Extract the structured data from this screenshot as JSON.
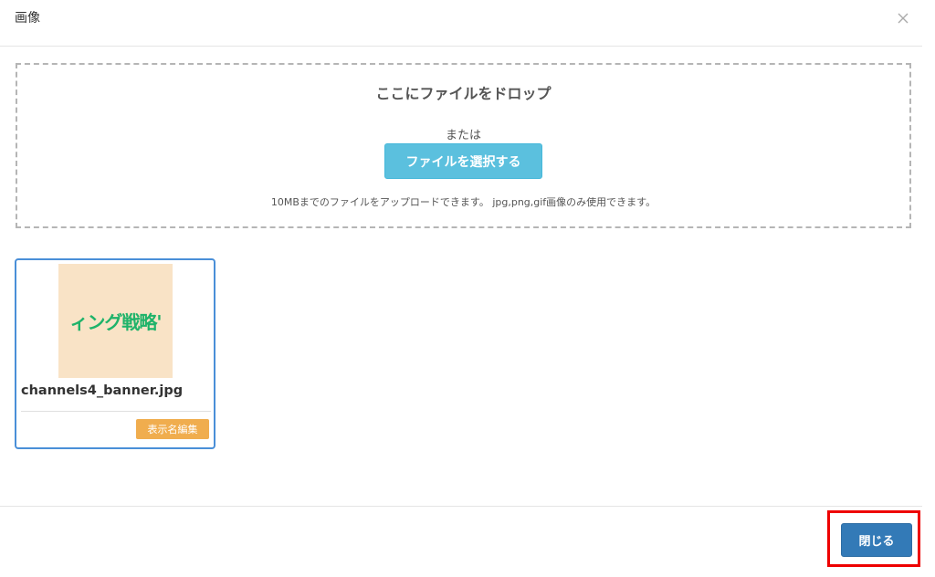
{
  "dialog": {
    "title": "画像",
    "close_icon": "close-icon"
  },
  "dropzone": {
    "title": "ここにファイルをドロップ",
    "or_text": "または",
    "select_button": "ファイルを選択する",
    "hint": "10MBまでのファイルをアップロードできます。 jpg,png,gif画像のみ使用できます。"
  },
  "files": [
    {
      "thumbnail_text": "ィング戦略'",
      "name": "channels4_banner.jpg",
      "edit_button": "表示名編集",
      "selected": true
    }
  ],
  "footer": {
    "close_button": "閉じる",
    "highlighted": true
  },
  "colors": {
    "primary": "#337ab7",
    "info": "#5bc0de",
    "warning": "#f0ad4e",
    "highlight": "#ee0000",
    "selected_border": "#4a8fd8",
    "thumb_bg": "#f9e3c6",
    "thumb_text": "#1fb36a"
  }
}
